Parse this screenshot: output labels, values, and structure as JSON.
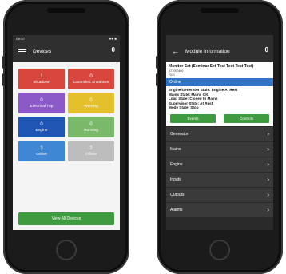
{
  "left_phone": {
    "status_time": "09:57",
    "status_right": "●● ■",
    "title": "Devices",
    "count": "0",
    "tiles": [
      {
        "num": "1",
        "label": "Shutdown",
        "color": "#d8463e"
      },
      {
        "num": "0",
        "label": "Controlled Shutdown",
        "color": "#d8463e"
      },
      {
        "num": "0",
        "label": "Electrical Trip",
        "color": "#8c5ac8"
      },
      {
        "num": "0",
        "label": "Warning",
        "color": "#e4c12c"
      },
      {
        "num": "0",
        "label": "Engine",
        "color": "#1f55b5"
      },
      {
        "num": "0",
        "label": "Running",
        "color": "#7ab96a"
      },
      {
        "num": "3",
        "label": "Online",
        "color": "#3f86d4"
      },
      {
        "num": "2",
        "label": "Offline",
        "color": "#bdbdbd"
      }
    ],
    "view_all": "View All Devices"
  },
  "right_phone": {
    "title": "Module Information",
    "count": "0",
    "module_title": "Monitor Set (Seminar Set Test Test Test Test)",
    "line1": "A77000400",
    "line2": "7031",
    "online": "Online",
    "states": [
      "Engine/Generator State: Engine At Rest",
      "Mains State: Mains OK",
      "Load State: Closed to Mains",
      "Supervisor State: At Rest",
      "Mode State: Stop"
    ],
    "events_btn": "Events",
    "controls_btn": "Controls",
    "menu": [
      "Generator",
      "Mains",
      "Engine",
      "Inputs",
      "Outputs",
      "Alarms"
    ]
  },
  "icons": {
    "back": "←",
    "chevron": "›"
  }
}
